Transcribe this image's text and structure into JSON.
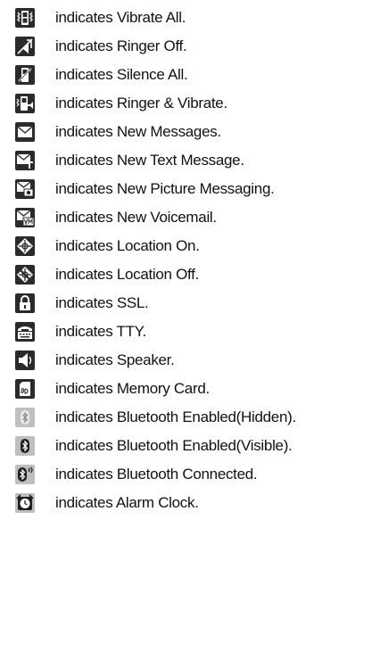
{
  "items": [
    {
      "icon": "vibrate-all-icon",
      "text": "indicates Vibrate All."
    },
    {
      "icon": "ringer-off-icon",
      "text": "indicates Ringer Off."
    },
    {
      "icon": "silence-all-icon",
      "text": "indicates Silence All."
    },
    {
      "icon": "ringer-vibrate-icon",
      "text": "indicates Ringer & Vibrate."
    },
    {
      "icon": "new-messages-icon",
      "text": "indicates New Messages."
    },
    {
      "icon": "new-text-message-icon",
      "text": "indicates New Text Message."
    },
    {
      "icon": "new-picture-messaging-icon",
      "text": "indicates New Picture Messaging."
    },
    {
      "icon": "new-voicemail-icon",
      "text": "indicates New Voicemail."
    },
    {
      "icon": "location-on-icon",
      "text": "indicates Location On."
    },
    {
      "icon": "location-off-icon",
      "text": "indicates Location Off."
    },
    {
      "icon": "ssl-lock-icon",
      "text": "indicates SSL."
    },
    {
      "icon": "tty-icon",
      "text": "indicates TTY."
    },
    {
      "icon": "speaker-icon",
      "text": "indicates Speaker."
    },
    {
      "icon": "memory-card-icon",
      "text": "indicates Memory Card."
    },
    {
      "icon": "bluetooth-hidden-icon",
      "text": "indicates Bluetooth Enabled(Hidden)."
    },
    {
      "icon": "bluetooth-visible-icon",
      "text": "indicates Bluetooth Enabled(Visible)."
    },
    {
      "icon": "bluetooth-connected-icon",
      "text": "indicates Bluetooth Connected."
    },
    {
      "icon": "alarm-clock-icon",
      "text": "indicates Alarm Clock."
    }
  ],
  "icon_colors": {
    "dark": "#2b2b2b",
    "light": "#bfbfbf",
    "white": "#ffffff"
  }
}
